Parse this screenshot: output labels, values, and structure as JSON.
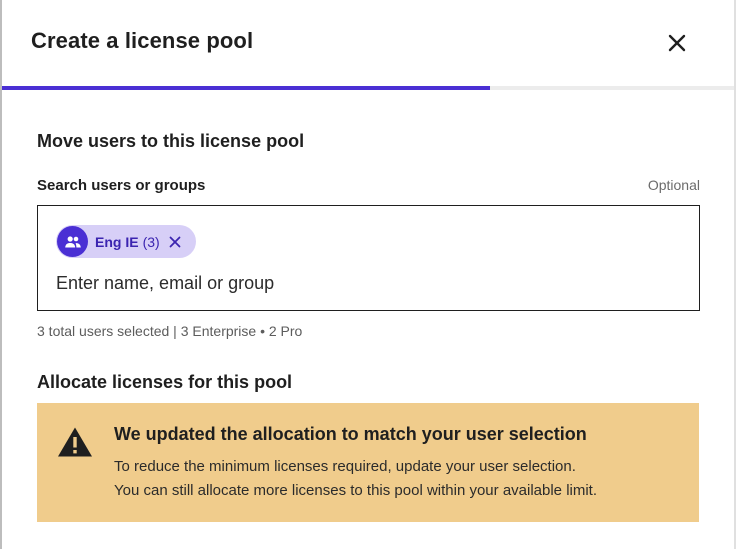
{
  "modal": {
    "title": "Create a license pool",
    "close_icon": "close-icon",
    "progress": 0.667
  },
  "move_users": {
    "heading": "Move users to this license pool",
    "field_label": "Search users or groups",
    "optional_label": "Optional",
    "chip": {
      "icon": "group-icon",
      "name": "Eng IE",
      "count": "(3)",
      "remove_icon": "close-icon"
    },
    "input_placeholder": "Enter name, email or group",
    "input_value": "",
    "helper_text": "3 total users selected | 3 Enterprise • 2 Pro"
  },
  "allocate": {
    "heading": "Allocate licenses for this pool",
    "alert": {
      "icon": "warning-icon",
      "title": "We updated the allocation to match your user selection",
      "line1": "To reduce the minimum licenses required, update your user selection.",
      "line2": "You can still allocate more licenses to this pool within your available limit."
    }
  },
  "colors": {
    "accent": "#4a2fd4",
    "chip_bg": "#d7cff7",
    "alert_bg": "#f0cc8c"
  }
}
